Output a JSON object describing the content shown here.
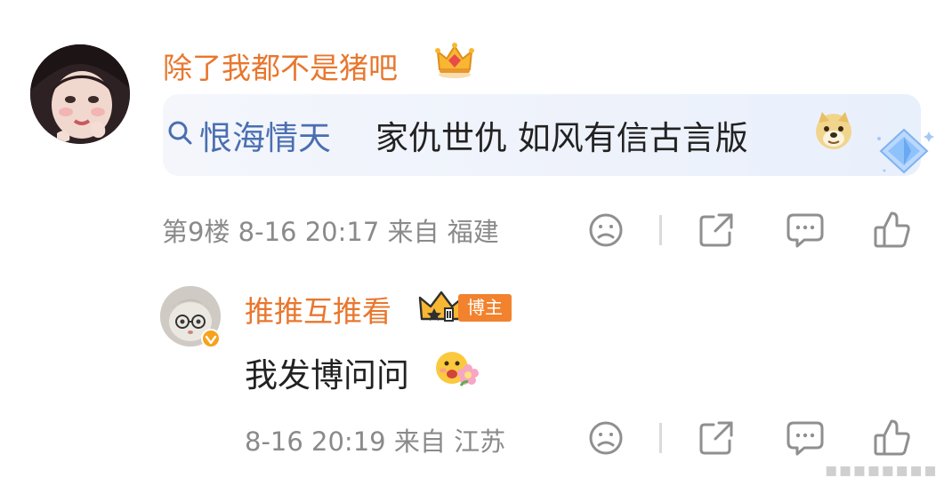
{
  "comments": [
    {
      "username": "除了我都不是猪吧",
      "topic": "恨海情天",
      "text": "家仇世仇 如风有信古言版",
      "floor": "第9楼",
      "time": "8-16 20:17",
      "from_label": "来自",
      "location": "福建",
      "crown_icon": "gold-crown-icon",
      "emoji": "doge-emoji"
    },
    {
      "username": "推推互推看",
      "badge": "博主",
      "text": "我发博问问",
      "time": "8-16 20:19",
      "from_label": "来自",
      "location": "江苏",
      "crown_icon": "fan-level-crown-icon",
      "emoji": "flower-face-emoji"
    }
  ],
  "actions": [
    "dislike-icon",
    "share-icon",
    "comment-icon",
    "like-icon"
  ],
  "colors": {
    "username": "#e8772e",
    "topic": "#4a6fb0",
    "meta": "#8a8a8a",
    "badge": "#f2822d"
  }
}
